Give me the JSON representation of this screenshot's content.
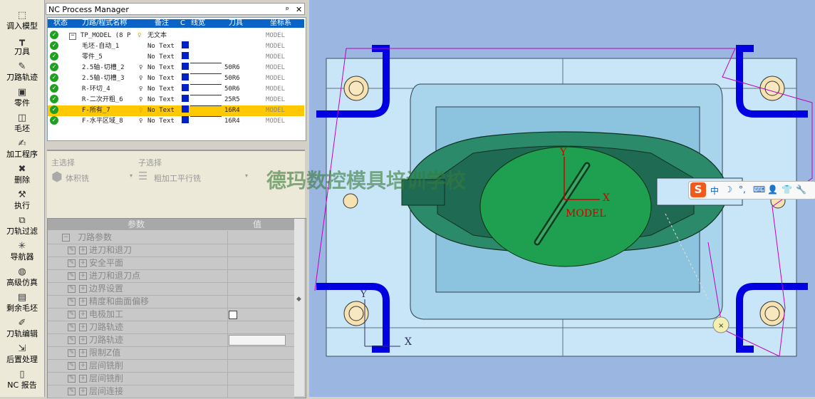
{
  "toolbar": [
    {
      "icon": "import-model-icon",
      "label": "调入模型"
    },
    {
      "icon": "tool-icon",
      "label": "刀具"
    },
    {
      "icon": "toolpath-icon",
      "label": "刀路轨迹"
    },
    {
      "icon": "part-icon",
      "label": "零件"
    },
    {
      "icon": "stock-icon",
      "label": "毛坯"
    },
    {
      "icon": "process-icon",
      "label": "加工程序"
    },
    {
      "icon": "delete-icon",
      "label": "删除"
    },
    {
      "icon": "execute-icon",
      "label": "执行"
    },
    {
      "icon": "filter-icon",
      "label": "刀轨过滤"
    },
    {
      "icon": "navigator-icon",
      "label": "导航器"
    },
    {
      "icon": "simulation-icon",
      "label": "高级仿真"
    },
    {
      "icon": "remaining-stock-icon",
      "label": "剩余毛坯"
    },
    {
      "icon": "edit-toolpath-icon",
      "label": "刀轨编辑"
    },
    {
      "icon": "post-process-icon",
      "label": "后置处理"
    },
    {
      "icon": "report-icon",
      "label": "NC 报告"
    }
  ],
  "nc_manager": {
    "title": "NC Process Manager",
    "pin": "ᵖ",
    "close": "✕",
    "headers": [
      "状态",
      "刀路/程式名称",
      "备注",
      "C",
      "线宽",
      "刀具",
      "坐标系"
    ],
    "rows": [
      {
        "name": "TP_MODEL (8 P",
        "note": "无文本",
        "tool": "",
        "cs": "MODEL",
        "expander": "−",
        "box": false,
        "line": false,
        "bulb": true
      },
      {
        "name": "毛坯-自动_1",
        "note": "No Text",
        "tool": "",
        "cs": "MODEL",
        "box": true,
        "line": false
      },
      {
        "name": "零件_5",
        "note": "No Text",
        "tool": "",
        "cs": "MODEL",
        "box": true,
        "line": false
      },
      {
        "name": "2.5轴-切槽_2",
        "note": "No Text",
        "tool": "50R6",
        "cs": "MODEL",
        "box": true,
        "line": true,
        "bulb": true
      },
      {
        "name": "2.5轴-切槽_3",
        "note": "No Text",
        "tool": "50R6",
        "cs": "MODEL",
        "box": true,
        "line": true,
        "bulb": true
      },
      {
        "name": "R-环切_4",
        "note": "No Text",
        "tool": "50R6",
        "cs": "MODEL",
        "box": true,
        "line": true,
        "bulb": true
      },
      {
        "name": "R-二次开粗_6",
        "note": "No Text",
        "tool": "25R5",
        "cs": "MODEL",
        "box": true,
        "line": true,
        "bulb": true
      },
      {
        "name": "F-所有_7",
        "note": "No Text",
        "tool": "16R4",
        "cs": "MODEL",
        "box": true,
        "line": true,
        "bulb": true,
        "selected": true
      },
      {
        "name": "F-水平区域_8",
        "note": "No Text",
        "tool": "16R4",
        "cs": "MODEL",
        "box": true,
        "line": true,
        "bulb": true
      }
    ]
  },
  "selection": {
    "main_label": "主选择",
    "main_value": "体积铣",
    "sub_label": "子选择",
    "sub_value": "粗加工平行铣"
  },
  "params": {
    "col_name": "参数",
    "col_value": "值",
    "group": "刀路参数",
    "items": [
      "进刀和退刀",
      "安全平面",
      "进刀和退刀点",
      "边界设置",
      "精度和曲面偏移",
      "电极加工",
      "刀路轨迹",
      "刀路轨迹",
      "限制Z值",
      "层间铣削",
      "层间铣削",
      "层间连接"
    ]
  },
  "viewport": {
    "watermark": "德玛数控模具培训学校",
    "axis_y": "Y",
    "axis_x": "X",
    "model_label": "MODEL",
    "wcs_y": "Y",
    "wcs_x": "X",
    "ime_logo": "S",
    "ime_items": [
      "中",
      "☽",
      "°,",
      "⌨",
      "👤",
      "👕",
      "🔧"
    ],
    "colors": {
      "bg": "#9bb6e0",
      "plate": "#c9e6f8",
      "cavity": "#2a8a6a",
      "pocket": "#1ea050",
      "clamp": "#0000e0",
      "path": "#c000c0"
    }
  }
}
